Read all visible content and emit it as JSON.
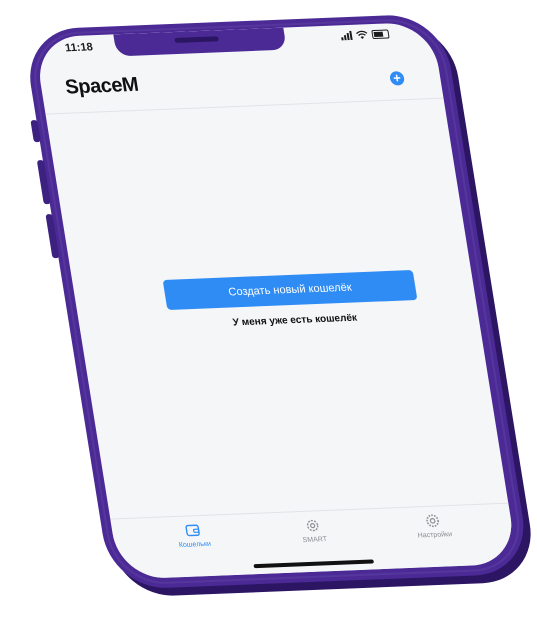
{
  "status_bar": {
    "time": "11:18"
  },
  "header": {
    "title": "SpaceM",
    "add_icon": "plus-circle-icon",
    "add_glyph": "+"
  },
  "main": {
    "create_wallet_label": "Создать новый кошелёк",
    "have_wallet_label": "У меня уже есть кошелёк"
  },
  "tab_bar": {
    "tabs": [
      {
        "label": "Кошельки",
        "icon": "wallet-icon",
        "active": true
      },
      {
        "label": "SMART",
        "icon": "smart-gear-icon",
        "active": false
      },
      {
        "label": "Настройки",
        "icon": "settings-gear-icon",
        "active": false
      }
    ]
  },
  "colors": {
    "accent": "#2f8cf5",
    "phone_frame": "#4b2a96",
    "screen_bg": "#f5f6f8",
    "inactive_tab": "#8e8e93"
  }
}
